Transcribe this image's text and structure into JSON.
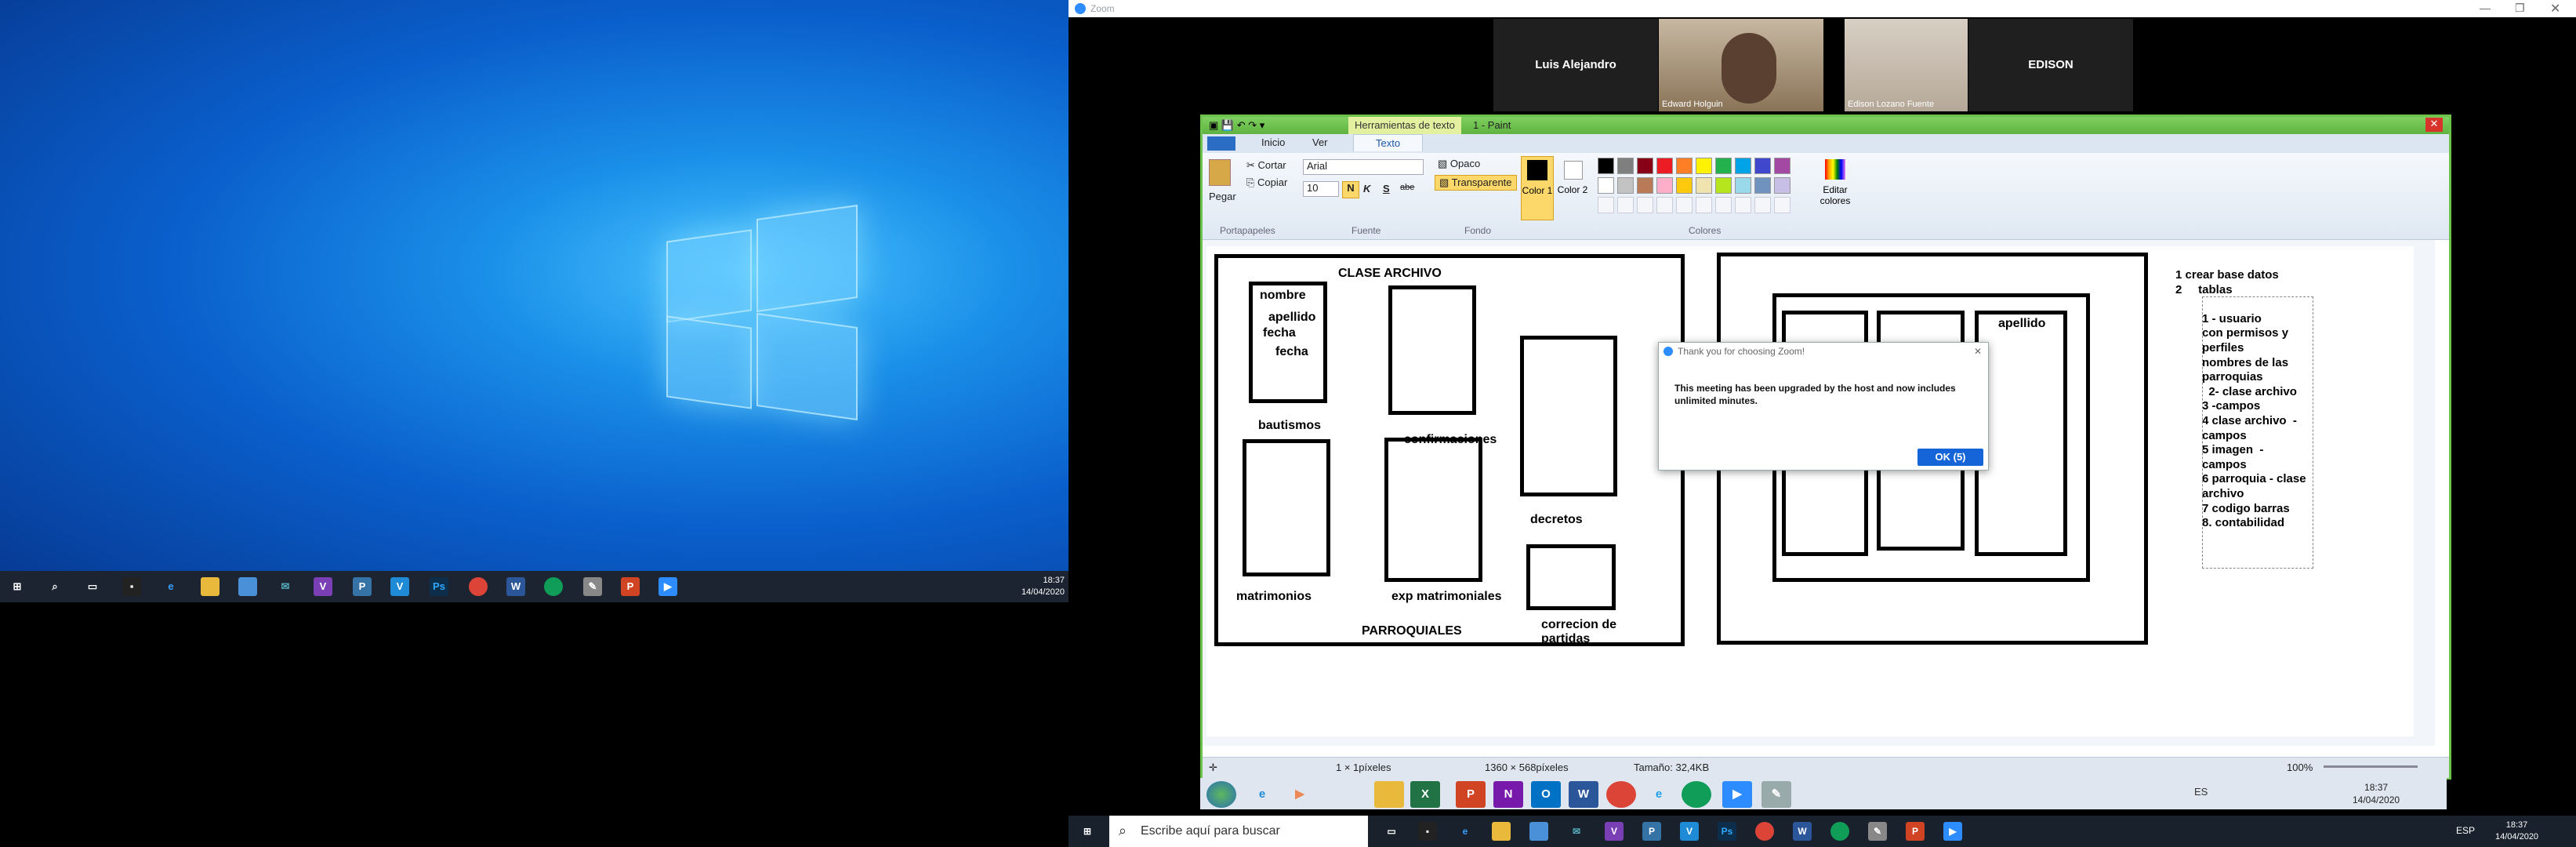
{
  "desktop": {
    "clock_time": "18:37",
    "clock_date": "14/04/2020"
  },
  "zoom": {
    "title": "Zoom",
    "participants": [
      {
        "name": "Luis Alejandro",
        "video": false
      },
      {
        "name": "Edward Holguin",
        "video": true
      },
      {
        "name": "Edison Lozano Fuente",
        "video": true
      },
      {
        "name": "EDISON",
        "video": false
      }
    ]
  },
  "paint": {
    "context_tab": "Herramientas de texto",
    "title": "1 - Paint",
    "tabs": [
      "Inicio",
      "Ver",
      "Texto"
    ],
    "clipboard": {
      "paste": "Pegar",
      "cut": "Cortar",
      "copy": "Copiar",
      "group": "Portapapeles"
    },
    "font": {
      "name": "Arial",
      "size": "10",
      "bold": "N",
      "italic": "K",
      "underline": "S",
      "strike": "abe",
      "group": "Fuente"
    },
    "background": {
      "opaque": "Opaco",
      "transparent": "Transparente",
      "group": "Fondo"
    },
    "colors": {
      "color1": "Color 1",
      "color2": "Color 2",
      "edit": "Editar colores",
      "group": "Colores",
      "palette": [
        "#000000",
        "#7f7f7f",
        "#880015",
        "#ed1c24",
        "#ff7f27",
        "#fff200",
        "#22b14c",
        "#00a2e8",
        "#3f48cc",
        "#a349a4",
        "#ffffff",
        "#c3c3c3",
        "#b97a57",
        "#ffaec9",
        "#ffc90e",
        "#efe4b0",
        "#b5e61d",
        "#99d9ea",
        "#7092be",
        "#c8bfe7"
      ]
    },
    "canvas": {
      "title": "CLASE ARCHIVO",
      "footer": "PARROQUIALES",
      "labels": [
        "nombre",
        "apellido",
        "fecha",
        "fecha",
        "bautismos",
        "confirmaciones",
        "decretos",
        "matrimonios",
        "exp matrimoniales",
        "correcion de",
        "partidas",
        "apellido"
      ],
      "notes": [
        "1 crear base datos",
        "2     tablas",
        "",
        "1 - usuario",
        "con permisos y",
        "perfiles",
        "nombres de las",
        "parroquias",
        "  2- clase archivo",
        "3 -campos",
        "4 clase archivo  -",
        "campos",
        "5 imagen  -",
        "campos",
        "6 parroquia - clase",
        "archivo",
        "7 codigo barras",
        "8. contabilidad"
      ]
    },
    "status": {
      "pos": "1 × 1píxeles",
      "size": "1360 × 568píxeles",
      "file": "Tamaño: 32,4KB",
      "zoom": "100%"
    }
  },
  "dialog": {
    "title": "Thank you for choosing Zoom!",
    "message": "This meeting has been upgraded by the host and now includes unlimited minutes.",
    "ok": "OK (5)"
  },
  "inner_taskbar": {
    "lang": "ES",
    "time": "18:37",
    "date": "14/04/2020"
  },
  "outer_taskbar": {
    "search_placeholder": "Escribe aquí para buscar",
    "lang": "ESP",
    "time": "18:37",
    "date": "14/04/2020"
  }
}
